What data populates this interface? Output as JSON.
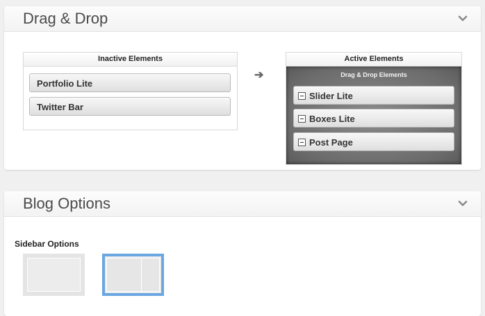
{
  "drag_drop": {
    "title": "Drag & Drop",
    "inactive": {
      "header": "Inactive Elements",
      "items": [
        "Portfolio Lite",
        "Twitter Bar"
      ]
    },
    "arrow": "➔",
    "active": {
      "header": "Active Elements",
      "subheader": "Drag & Drop Elements",
      "items": [
        "Slider Lite",
        "Boxes Lite",
        "Post Page"
      ]
    }
  },
  "blog_options": {
    "title": "Blog Options",
    "sidebar_label": "Sidebar Options",
    "layouts": [
      "no-sidebar-layout",
      "right-sidebar-layout"
    ],
    "selected_layout": "right-sidebar-layout"
  },
  "colors": {
    "selected_layout_border": "#6aa7e0",
    "active_panel_bg": "#6c6c6c"
  },
  "icons": {
    "collapse": "chevron-down-icon",
    "remove": "minus-icon"
  }
}
